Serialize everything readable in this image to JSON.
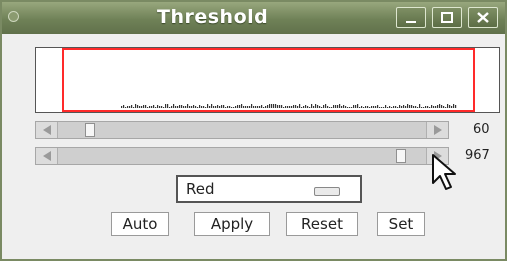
{
  "window": {
    "title": "Threshold"
  },
  "titlebar_icons": {
    "menu": "window-menu-icon",
    "minimize": "minimize-icon",
    "maximize": "maximize-icon",
    "close": "close-icon"
  },
  "histogram": {
    "min_threshold": 60,
    "max_threshold": 967
  },
  "sliders": [
    {
      "name": "min",
      "value": "60",
      "position_fraction": 0.05
    },
    {
      "name": "max",
      "value": "967",
      "position_fraction": 0.95
    }
  ],
  "channel_select": {
    "selected": "Red"
  },
  "buttons": {
    "auto": "Auto",
    "apply": "Apply",
    "reset": "Reset",
    "set": "Set"
  },
  "colors": {
    "threshold_line": "#ff2a2a",
    "titlebar": "#6f8157"
  }
}
